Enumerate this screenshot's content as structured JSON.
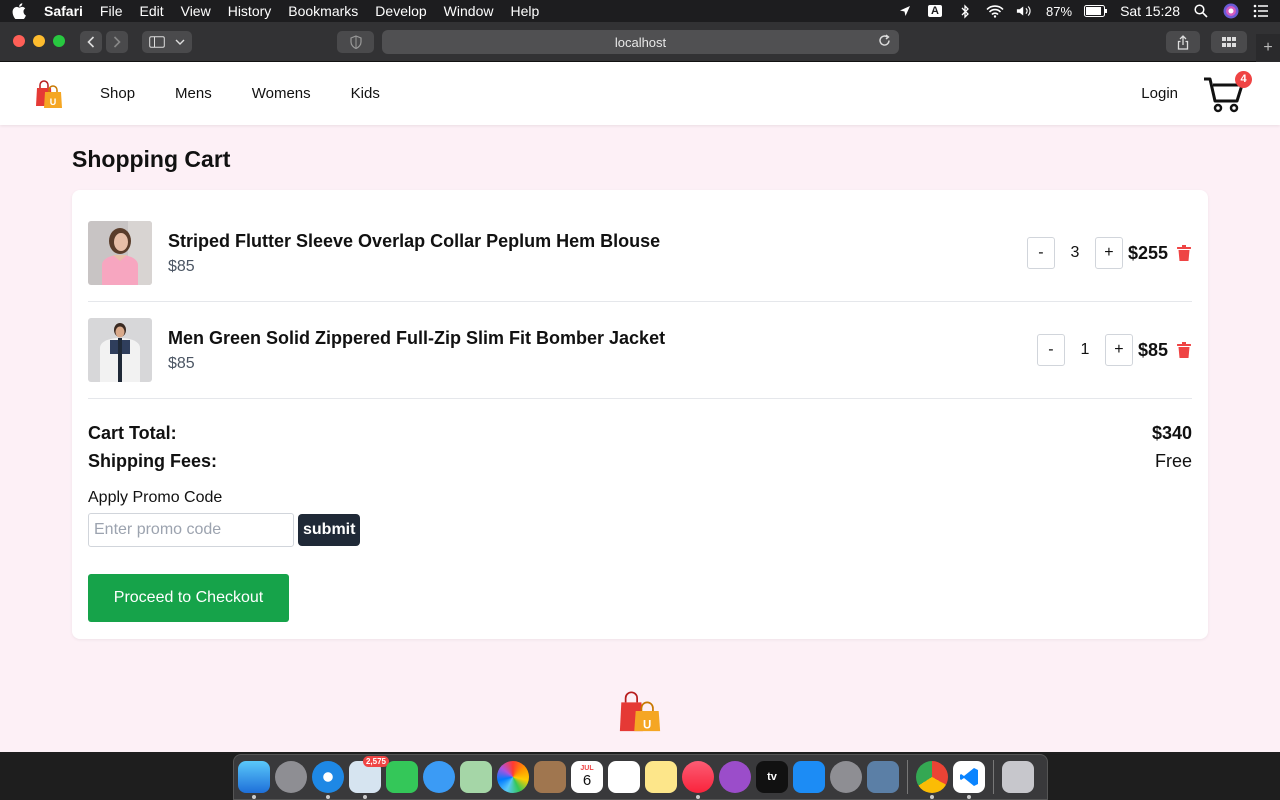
{
  "menubar": {
    "app_name": "Safari",
    "items": [
      "File",
      "Edit",
      "View",
      "History",
      "Bookmarks",
      "Develop",
      "Window",
      "Help"
    ],
    "battery": "87%",
    "clock": "Sat 15:28",
    "input_source": "A"
  },
  "browser": {
    "url": "localhost"
  },
  "navbar": {
    "links": [
      "Shop",
      "Mens",
      "Womens",
      "Kids"
    ],
    "login_label": "Login",
    "cart_count": "4",
    "logo_letter": "U"
  },
  "cart": {
    "title": "Shopping Cart",
    "items": [
      {
        "name": "Striped Flutter Sleeve Overlap Collar Peplum Hem Blouse",
        "price": "$85",
        "quantity": "3",
        "line_total": "$255",
        "minus": "-",
        "plus": "+"
      },
      {
        "name": "Men Green Solid Zippered Full-Zip Slim Fit Bomber Jacket",
        "price": "$85",
        "quantity": "1",
        "line_total": "$85",
        "minus": "-",
        "plus": "+"
      }
    ],
    "total_label": "Cart Total:",
    "total_value": "$340",
    "shipping_label": "Shipping Fees:",
    "shipping_value": "Free",
    "promo_title": "Apply Promo Code",
    "promo_placeholder": "Enter promo code",
    "promo_submit": "submit",
    "checkout_label": "Proceed to Checkout"
  },
  "dock": {
    "mail_badge": "2,575",
    "calendar_day": "6",
    "calendar_month": "JUL",
    "tv_label": "tv"
  },
  "colors": {
    "page_bg": "#fdf0f6",
    "checkout_green": "#16a34a",
    "trash_red": "#ef4444",
    "promo_button": "#1f2937"
  }
}
